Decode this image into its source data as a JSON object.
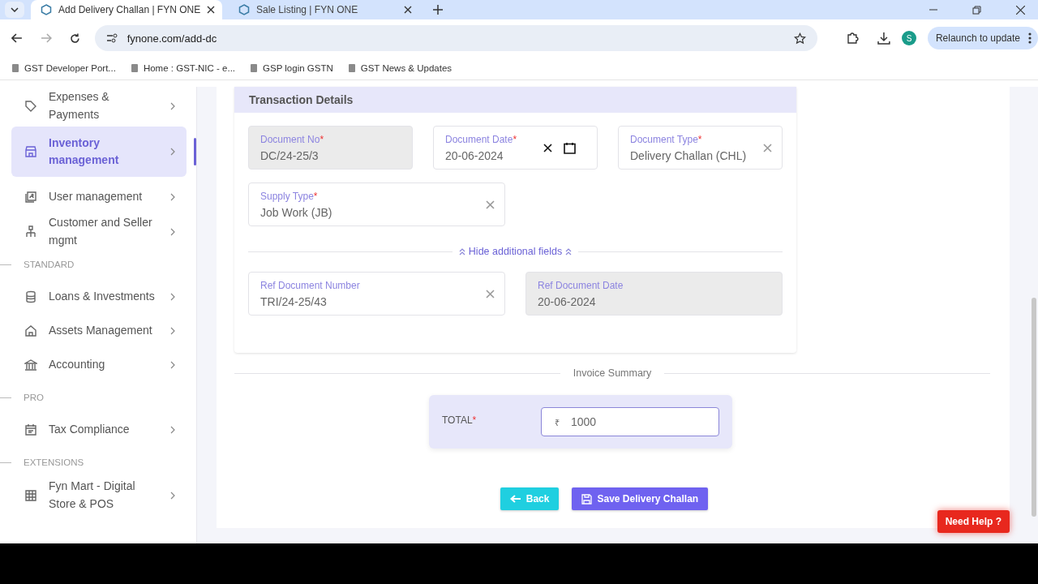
{
  "browser": {
    "tabs": [
      {
        "title": "Add Delivery Challan | FYN ONE",
        "selected": true
      },
      {
        "title": "Sale Listing | FYN ONE",
        "selected": false
      }
    ],
    "address": "fynone.com/add-dc",
    "bookmarks": [
      "GST Developer Port...",
      "Home : GST-NIC - e...",
      "GSP login GSTN",
      "GST News & Updates"
    ],
    "profile": "S",
    "relaunch": "Relaunch to update"
  },
  "sidebar": [
    {
      "kind": "item",
      "label": "Expenses & Payments",
      "selected": false
    },
    {
      "kind": "item",
      "label": "Inventory management",
      "selected": true
    },
    {
      "kind": "item",
      "label": "User management",
      "selected": false
    },
    {
      "kind": "item",
      "label": "Customer and Seller mgmt",
      "selected": false
    },
    {
      "kind": "section",
      "label": "STANDARD"
    },
    {
      "kind": "item",
      "label": "Loans & Investments",
      "selected": false
    },
    {
      "kind": "item",
      "label": "Assets Management",
      "selected": false
    },
    {
      "kind": "item",
      "label": "Accounting",
      "selected": false
    },
    {
      "kind": "section",
      "label": "PRO"
    },
    {
      "kind": "item",
      "label": "Tax Compliance",
      "selected": false
    },
    {
      "kind": "section",
      "label": "EXTENSIONS"
    },
    {
      "kind": "item",
      "label": "Fyn Mart - Digital Store & POS",
      "selected": false
    }
  ],
  "required_mark": "*",
  "transaction": {
    "title": "Transaction Details",
    "rows": [
      {
        "fields": [
          {
            "kind": "text",
            "label": "Document No",
            "required": true,
            "value": "DC/24-25/3",
            "disabled": true,
            "clearable": false
          },
          {
            "kind": "date",
            "label": "Document Date",
            "required": true,
            "value": "20-06-2024",
            "disabled": false,
            "clearable": true
          },
          {
            "kind": "text",
            "label": "Document Type",
            "required": true,
            "value": "Delivery Challan (CHL)",
            "disabled": false,
            "clearable": true
          }
        ]
      },
      {
        "fields": [
          {
            "kind": "text",
            "label": "Supply Type",
            "required": true,
            "value": "Job Work (JB)",
            "disabled": false,
            "clearable": true
          }
        ]
      }
    ],
    "toggle": "Hide additional fields",
    "extra_rows": [
      {
        "fields": [
          {
            "label": "Ref Document Number",
            "required": false,
            "value": "TRI/24-25/43",
            "disabled": false,
            "clearable": true
          },
          {
            "label": "Ref Document Date",
            "required": false,
            "value": "20-06-2024",
            "disabled": true,
            "clearable": false
          }
        ]
      }
    ]
  },
  "summary": {
    "title": "Invoice Summary",
    "total_label": "TOTAL",
    "required": true,
    "currency": "₹",
    "total": "1000"
  },
  "buttons": {
    "back": "Back",
    "save": "Save Delivery Challan"
  },
  "help": "Need Help ?"
}
